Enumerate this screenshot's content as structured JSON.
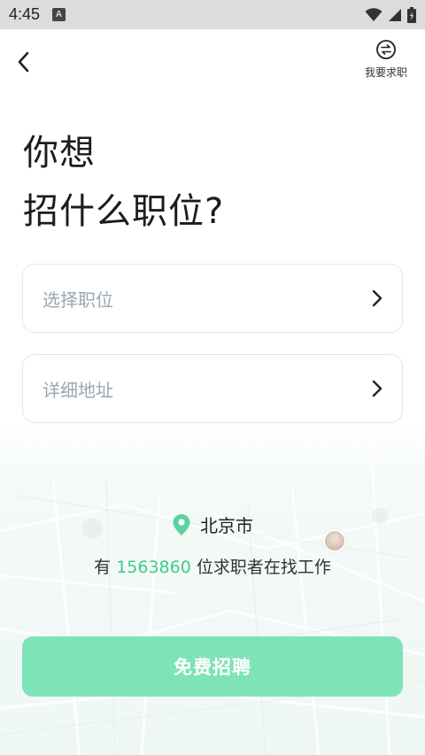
{
  "status_bar": {
    "time": "4:45",
    "icons": [
      "a-notification-icon",
      "wifi-icon",
      "cell-signal-icon",
      "battery-icon"
    ]
  },
  "header": {
    "back_icon": "chevron-left-icon",
    "switch_icon": "switch-arrows-icon",
    "switch_label": "我要求职"
  },
  "title": {
    "line1": "你想",
    "line2": "招什么职位?"
  },
  "form": {
    "position_placeholder": "选择职位",
    "address_placeholder": "详细地址"
  },
  "location": {
    "pin_icon": "location-pin-icon",
    "city": "北京市",
    "count_prefix": "有 ",
    "count": "1563860",
    "count_suffix": " 位求职者在找工作"
  },
  "cta": {
    "label": "免费招聘"
  },
  "colors": {
    "accent": "#3fcb8f",
    "cta_bg": "#7fe3b8",
    "placeholder": "#9aa6b2",
    "border": "#e3e6e8"
  }
}
